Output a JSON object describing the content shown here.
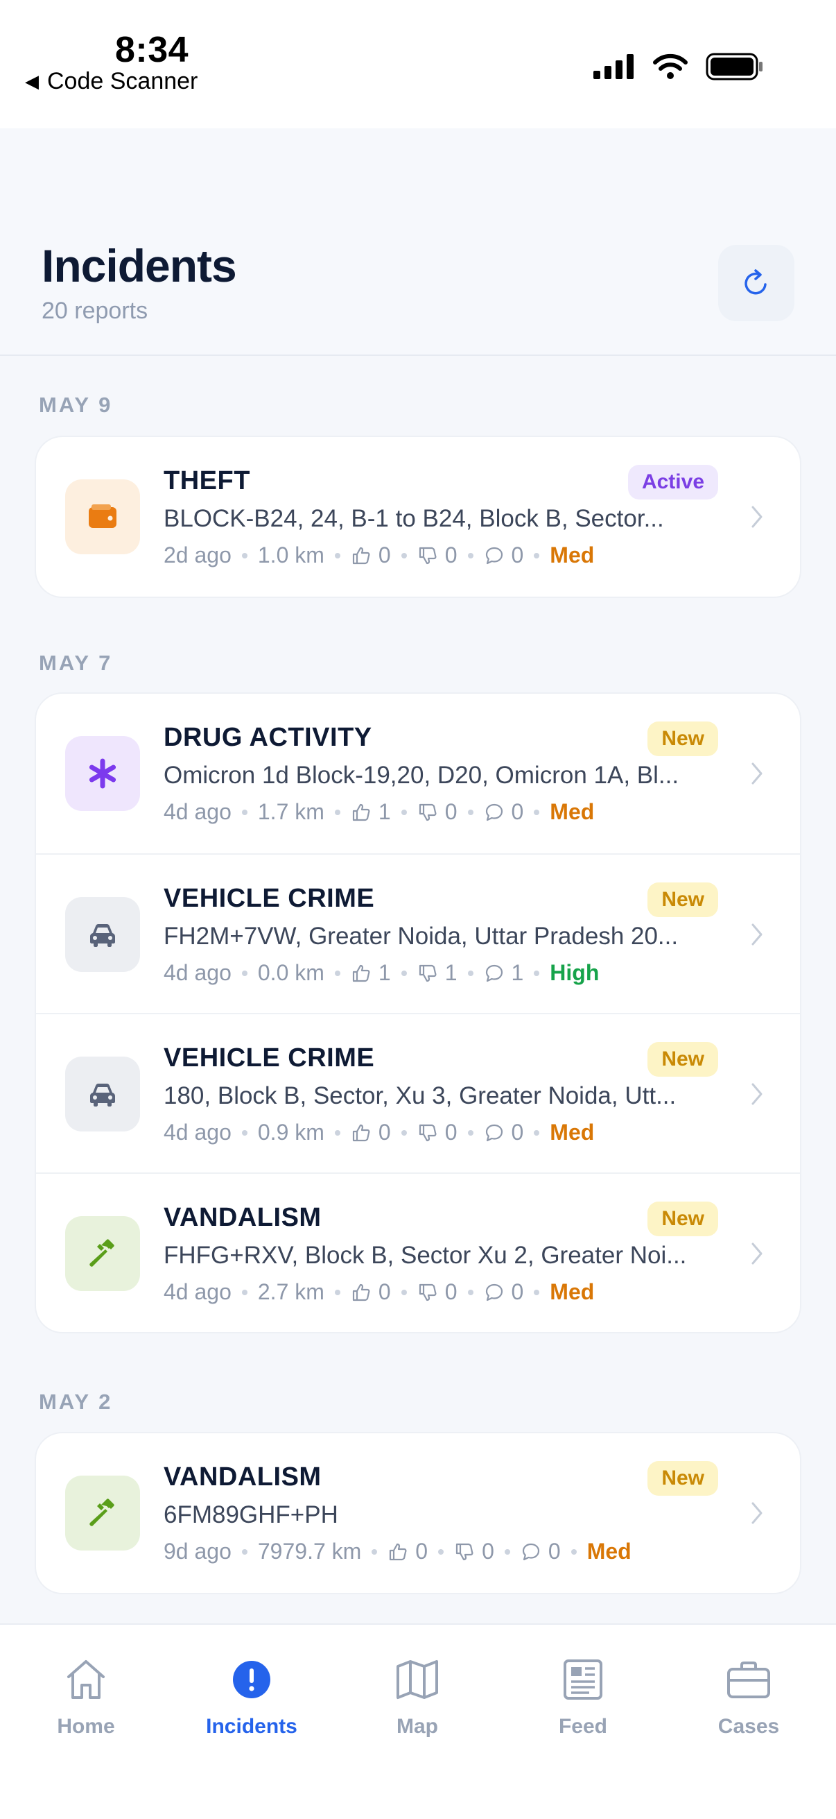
{
  "status_bar": {
    "time": "8:34",
    "back_app": "Code Scanner"
  },
  "header": {
    "title": "Incidents",
    "subtitle": "20 reports"
  },
  "sections": [
    {
      "label": "MAY 9",
      "items": [
        {
          "title": "THEFT",
          "status": "Active",
          "address": "BLOCK-B24, 24, B-1 to B24, Block B, Sector...",
          "time": "2d ago",
          "distance": "1.0 km",
          "likes": "0",
          "dislikes": "0",
          "comments": "0",
          "severity": "Med",
          "icon": "wallet-icon"
        }
      ]
    },
    {
      "label": "MAY 7",
      "items": [
        {
          "title": "DRUG ACTIVITY",
          "status": "New",
          "address": "Omicron 1d Block-19,20, D20, Omicron 1A, Bl...",
          "time": "4d ago",
          "distance": "1.7 km",
          "likes": "1",
          "dislikes": "0",
          "comments": "0",
          "severity": "Med",
          "icon": "asterisk-icon"
        },
        {
          "title": "VEHICLE CRIME",
          "status": "New",
          "address": "FH2M+7VW, Greater Noida, Uttar Pradesh 20...",
          "time": "4d ago",
          "distance": "0.0 km",
          "likes": "1",
          "dislikes": "1",
          "comments": "1",
          "severity": "High",
          "icon": "car-icon"
        },
        {
          "title": "VEHICLE CRIME",
          "status": "New",
          "address": "180, Block B, Sector, Xu 3, Greater Noida, Utt...",
          "time": "4d ago",
          "distance": "0.9 km",
          "likes": "0",
          "dislikes": "0",
          "comments": "0",
          "severity": "Med",
          "icon": "car-icon"
        },
        {
          "title": "VANDALISM",
          "status": "New",
          "address": "FHFG+RXV, Block B, Sector Xu 2, Greater Noi...",
          "time": "4d ago",
          "distance": "2.7 km",
          "likes": "0",
          "dislikes": "0",
          "comments": "0",
          "severity": "Med",
          "icon": "hammer-icon"
        }
      ]
    },
    {
      "label": "MAY 2",
      "items": [
        {
          "title": "VANDALISM",
          "status": "New",
          "address": "6FM89GHF+PH",
          "time": "9d ago",
          "distance": "7979.7 km",
          "likes": "0",
          "dislikes": "0",
          "comments": "0",
          "severity": "Med",
          "icon": "hammer-icon"
        }
      ]
    }
  ],
  "tabs": [
    {
      "label": "Home",
      "icon": "home-icon",
      "active": false
    },
    {
      "label": "Incidents",
      "icon": "alert-icon",
      "active": true
    },
    {
      "label": "Map",
      "icon": "map-icon",
      "active": false
    },
    {
      "label": "Feed",
      "icon": "newspaper-icon",
      "active": false
    },
    {
      "label": "Cases",
      "icon": "briefcase-icon",
      "active": false
    }
  ],
  "colors": {
    "accent": "#2563eb",
    "severity_med": "#d97706",
    "severity_high": "#16a34a",
    "badge_active": "#7b3fe4",
    "badge_new": "#c98a06"
  }
}
